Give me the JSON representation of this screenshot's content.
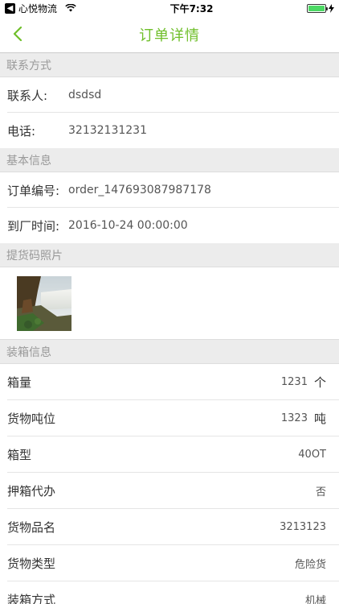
{
  "status_bar": {
    "carrier": "心悦物流",
    "time": "下午7:32",
    "battery_level": 1.0
  },
  "nav": {
    "title": "订单详情"
  },
  "contact": {
    "header": "联系方式",
    "person_label": "联系人:",
    "person_value": "dsdsd",
    "phone_label": "电话:",
    "phone_value": "32132131231"
  },
  "basic": {
    "header": "基本信息",
    "order_label": "订单编号:",
    "order_value": "order_147693087987178",
    "arrival_label": "到厂时间:",
    "arrival_value": "2016-10-24 00:00:00"
  },
  "photo": {
    "header": "提货码照片"
  },
  "container": {
    "header": "装箱信息",
    "rows": [
      {
        "label": "箱量",
        "value": "1231",
        "unit": "个"
      },
      {
        "label": "货物吨位",
        "value": "1323",
        "unit": "吨"
      },
      {
        "label": "箱型",
        "value": "40OT",
        "unit": ""
      },
      {
        "label": "押箱代办",
        "value": "否",
        "unit": ""
      },
      {
        "label": "货物品名",
        "value": "3213123",
        "unit": ""
      },
      {
        "label": "货物类型",
        "value": "危险货",
        "unit": ""
      },
      {
        "label": "装箱方式",
        "value": "机械",
        "unit": ""
      }
    ]
  },
  "colors": {
    "accent": "#6fbf2a",
    "section_bg": "#ececec"
  }
}
